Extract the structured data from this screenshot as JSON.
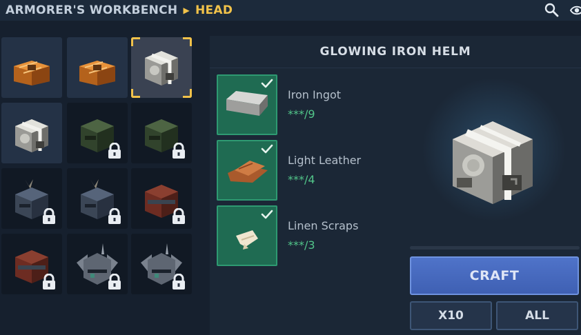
{
  "header": {
    "breadcrumb_root": "ARMORER'S WORKBENCH",
    "breadcrumb_separator_icon": "triangle-right-icon",
    "breadcrumb_current": "HEAD",
    "icons": [
      "search-icon",
      "eye-icon"
    ]
  },
  "colors": {
    "accent_gold": "#f1c24a",
    "material_ok_bg": "#1f6b52",
    "count_green": "#52c68a",
    "craft_blue": "#4f73c9"
  },
  "recipe_grid": {
    "slots": [
      {
        "item": "bronze-helm",
        "state": "owned"
      },
      {
        "item": "bronze-helm",
        "state": "owned"
      },
      {
        "item": "glowing-iron-helm",
        "state": "selected"
      },
      {
        "item": "iron-helm",
        "state": "owned"
      },
      {
        "item": "green-helm",
        "state": "locked"
      },
      {
        "item": "green-helm",
        "state": "locked"
      },
      {
        "item": "plumed-steel-helm",
        "state": "locked"
      },
      {
        "item": "plumed-steel-helm",
        "state": "locked"
      },
      {
        "item": "red-steel-helm",
        "state": "locked"
      },
      {
        "item": "red-steel-helm",
        "state": "locked"
      },
      {
        "item": "winged-helm",
        "state": "locked"
      },
      {
        "item": "winged-helm",
        "state": "locked"
      }
    ]
  },
  "detail": {
    "title": "GLOWING IRON HELM",
    "materials": [
      {
        "name": "Iron Ingot",
        "count": "***/9",
        "icon": "iron-ingot-icon",
        "available": true
      },
      {
        "name": "Light Leather",
        "count": "***/4",
        "icon": "leather-icon",
        "available": true
      },
      {
        "name": "Linen Scraps",
        "count": "***/3",
        "icon": "linen-icon",
        "available": true
      }
    ],
    "progress": 0,
    "craft_label": "CRAFT",
    "x10_label": "X10",
    "all_label": "ALL"
  }
}
